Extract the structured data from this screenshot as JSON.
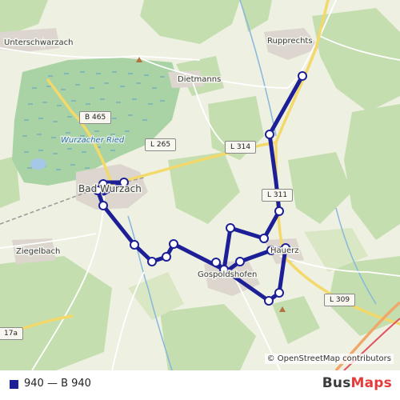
{
  "map": {
    "places": [
      {
        "key": "unterschwarzach",
        "label": "Unterschwarzach"
      },
      {
        "key": "rupprechts",
        "label": "Rupprechts"
      },
      {
        "key": "dietmanns",
        "label": "Dietmanns"
      },
      {
        "key": "wurzacher_ried",
        "label": "Wurzacher Ried"
      },
      {
        "key": "bad_wurzach",
        "label": "Bad Wurzach"
      },
      {
        "key": "ziegelbach",
        "label": "Ziegelbach"
      },
      {
        "key": "gospoldshofen",
        "label": "Gospoldshofen"
      },
      {
        "key": "hauerz",
        "label": "Hauerz"
      }
    ],
    "road_shields": {
      "b465": "B 465",
      "l265": "L 265",
      "l314": "L 314",
      "l311": "L 311",
      "l309": "L 309",
      "l17a": "17a"
    },
    "route_color": "#1c1f96",
    "attribution": "© OpenStreetMap contributors"
  },
  "legend": {
    "color": "#1c1f96",
    "label": "940 — B 940"
  },
  "brand": {
    "part1": "Bus",
    "part2": "Maps"
  }
}
